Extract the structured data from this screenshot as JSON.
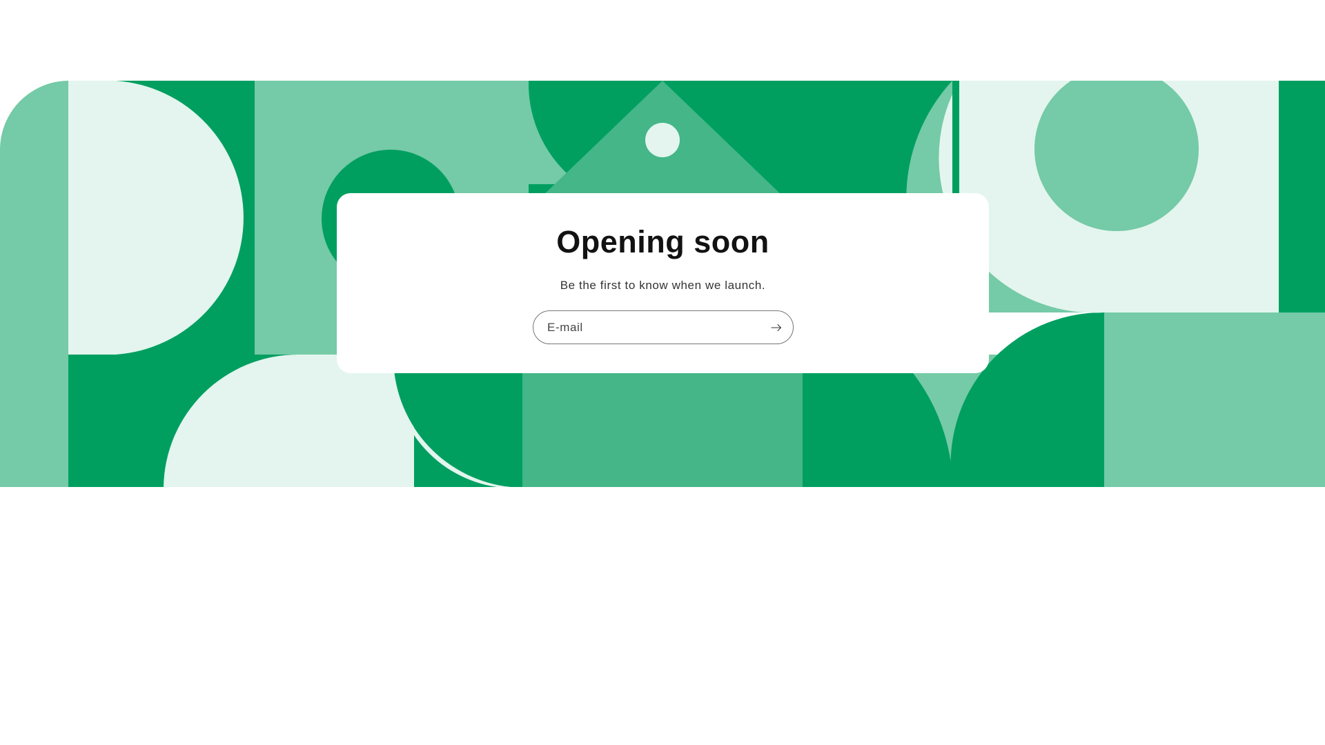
{
  "hero": {
    "title": "Opening soon",
    "subtitle": "Be the first to know when we launch."
  },
  "newsletter": {
    "email_placeholder": "E-mail",
    "email_value": "",
    "submit_icon": "arrow-right-icon"
  },
  "colors": {
    "dark_green": "#009f60",
    "mid_green": "#44b688",
    "light_green": "#75caa7",
    "pale_green": "#e3f5ee",
    "card_background": "#ffffff",
    "title_text": "#121212",
    "body_text": "#333333"
  }
}
